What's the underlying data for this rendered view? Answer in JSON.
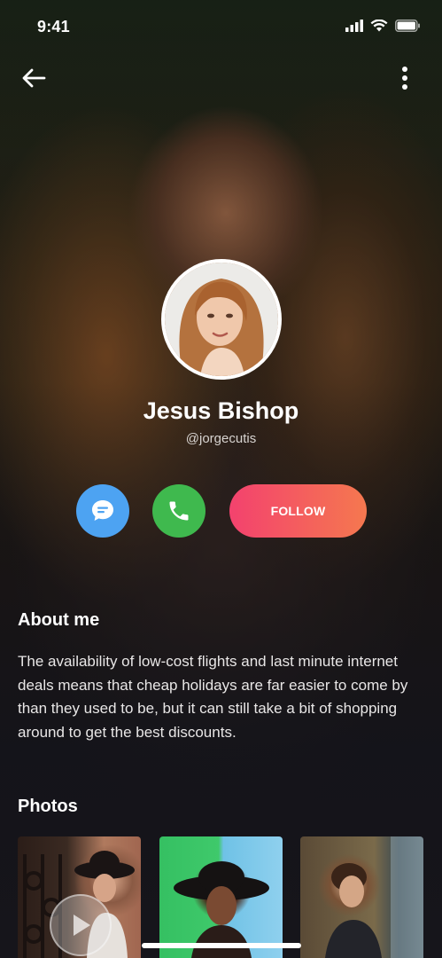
{
  "status_bar": {
    "time": "9:41"
  },
  "header": {
    "back_icon": "arrow-left-icon",
    "menu_icon": "more-vertical-icon"
  },
  "profile": {
    "name": "Jesus Bishop",
    "handle": "@jorgecutis"
  },
  "actions": {
    "message_icon": "chat-bubble-icon",
    "call_icon": "phone-icon",
    "follow_label": "FOLLOW",
    "colors": {
      "message": "#4da3f2",
      "call": "#3fb94e",
      "follow_start": "#f3426e",
      "follow_end": "#f5784f"
    }
  },
  "about": {
    "title": "About me",
    "text": "The availability of low-cost flights and last minute internet deals means that cheap holidays are far easier to come by than they used to be, but it can still take a bit of shopping around to get the best discounts."
  },
  "photos": {
    "title": "Photos",
    "items": [
      "photo-1",
      "photo-2",
      "photo-3"
    ],
    "play_icon": "play-icon"
  }
}
